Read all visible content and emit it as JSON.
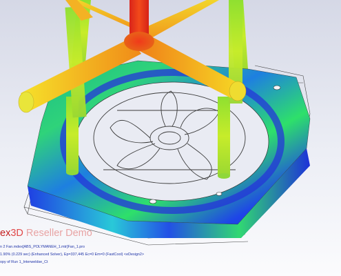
{
  "brand": {
    "part1": "ex",
    "part2": "3D",
    "part3": " Reseller Demo"
  },
  "status": {
    "line1": "n 2 Fan.mdex[ABS_POLYMANEH_1.mtr]Fan_1.pro",
    "line2": "1.90% (0.229 sec) (Enhanced Solver), Ep=337,445 Ec=0 Em=0 (FastCool) <eDesign2>",
    "line3": "opy of Run 1_Interweldse_Ct"
  },
  "colors": {
    "cool": "#1e35e6",
    "mid": "#25d08a",
    "warm": "#f7d21d",
    "hot": "#e42a16",
    "wireframe": "#3a3a3a",
    "brand_red": "#c41e1e"
  }
}
